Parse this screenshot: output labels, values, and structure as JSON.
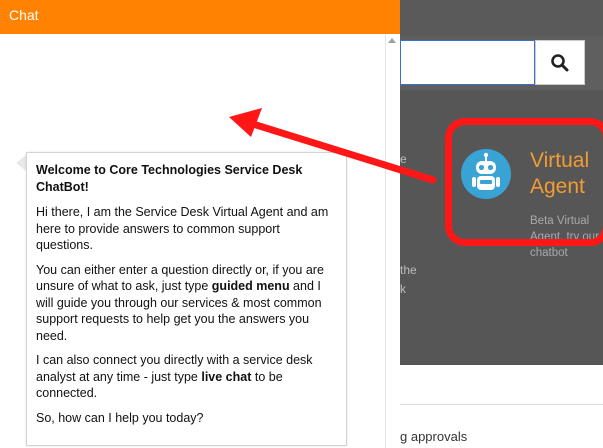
{
  "chat": {
    "title": "Chat",
    "header_color": "#ff8200",
    "message": {
      "heading": "Welcome to Core Technologies Service Desk ChatBot!",
      "p1": "Hi there, I am the Service Desk Virtual Agent and am here to provide answers to common support questions.",
      "p2_before": "You can either enter a question directly or, if you are unsure of what to ask, just type ",
      "p2_keyword": "guided menu",
      "p2_after": " and I will guide you through our services & most common support requests to help get you the answers you need.",
      "p3_before": "I can also connect you directly with a service desk analyst at any time - just type ",
      "p3_keyword": "live chat",
      "p3_after": " to be connected.",
      "p4": "So, how can I help you today?"
    }
  },
  "background": {
    "search": {
      "icon": "search-icon"
    },
    "virtual_agent_tile": {
      "icon": "robot-icon",
      "title": "Virtual\nAgent",
      "description": "Beta Virtual Agent, try our chatbot",
      "title_color": "#f39c33"
    },
    "fragments": {
      "f1": "e",
      "f2": "the",
      "f3": "k"
    },
    "approvals_text": "g approvals"
  },
  "annotation": {
    "arrow_color": "#ff1717",
    "highlight_color": "#ff1717"
  }
}
